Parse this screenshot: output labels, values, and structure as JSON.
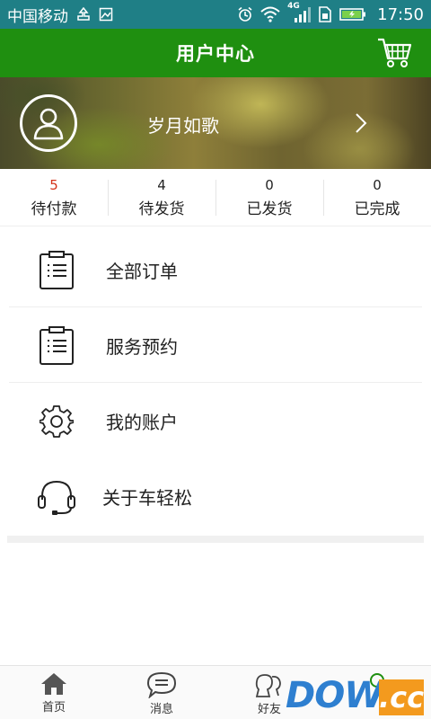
{
  "status_bar": {
    "carrier": "中国移动",
    "network": "4G",
    "time": "17:50"
  },
  "header": {
    "title": "用户中心",
    "cart_icon": "cart-icon"
  },
  "profile": {
    "username": "岁月如歌",
    "avatar_icon": "user-icon",
    "chevron_icon": "chevron-right-icon"
  },
  "order_stats": [
    {
      "count": "5",
      "label": "待付款",
      "count_color": "#d4331a"
    },
    {
      "count": "4",
      "label": "待发货"
    },
    {
      "count": "0",
      "label": "已发货"
    },
    {
      "count": "0",
      "label": "已完成"
    }
  ],
  "menu": [
    {
      "label": "全部订单",
      "icon": "clipboard-list-icon"
    },
    {
      "label": "服务预约",
      "icon": "clipboard-list-icon"
    },
    {
      "label": "我的账户",
      "icon": "gear-icon"
    },
    {
      "label": "关于车轻松",
      "icon": "headset-icon"
    }
  ],
  "bottom_nav": [
    {
      "label": "首页",
      "icon": "home-icon"
    },
    {
      "label": "消息",
      "icon": "message-icon"
    },
    {
      "label": "好友",
      "icon": "friends-icon"
    }
  ],
  "watermark": {
    "text": "DOWN",
    "suffix": ".cc"
  },
  "colors": {
    "status_bar": "#1f7f86",
    "header": "#1f8f10",
    "pending_count": "#d4331a"
  }
}
